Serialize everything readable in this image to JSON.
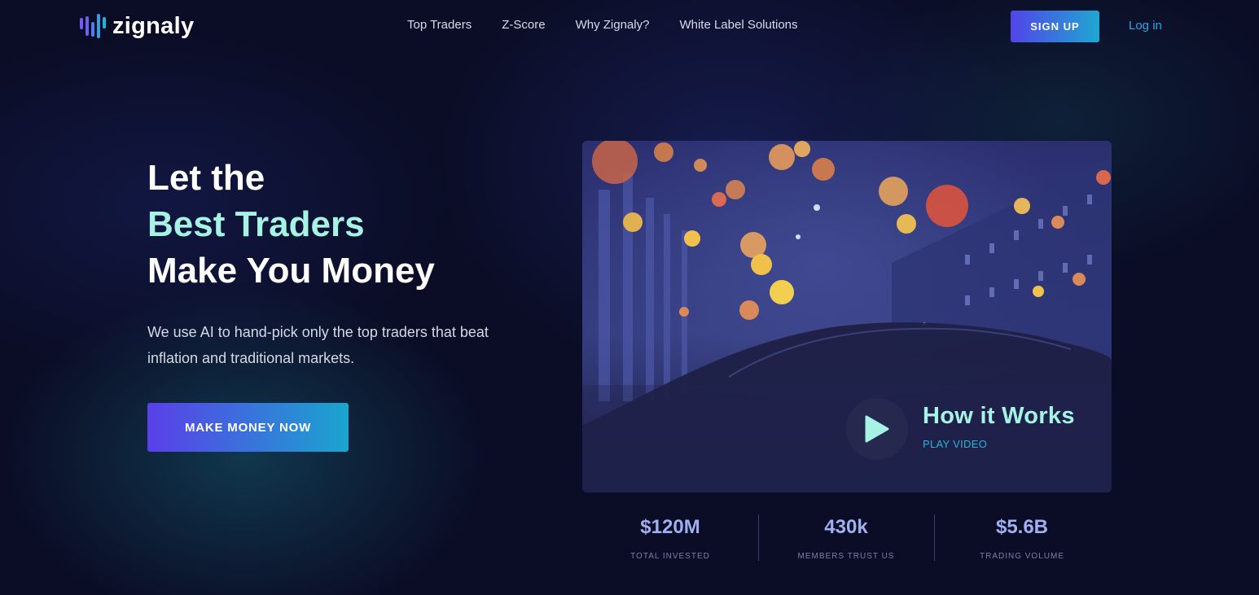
{
  "brand": {
    "name": "zignaly"
  },
  "nav": {
    "items": [
      {
        "label": "Top Traders"
      },
      {
        "label": "Z-Score"
      },
      {
        "label": "Why Zignaly?"
      },
      {
        "label": "White Label Solutions"
      }
    ],
    "signup_label": "SIGN UP",
    "login_label": "Log in"
  },
  "hero": {
    "line1": "Let the",
    "line2": "Best Traders",
    "line3": "Make You Money",
    "subtitle": "We use AI to hand-pick only the top traders that beat inflation and traditional markets.",
    "cta_label": "MAKE MONEY NOW"
  },
  "video": {
    "title": "How it Works",
    "subtitle": "PLAY VIDEO",
    "play_icon": "play-icon"
  },
  "stats": [
    {
      "value": "$120M",
      "label": "TOTAL INVESTED"
    },
    {
      "value": "430k",
      "label": "MEMBERS TRUST US"
    },
    {
      "value": "$5.6B",
      "label": "TRADING VOLUME"
    }
  ],
  "colors": {
    "background": "#0b0d26",
    "accent_mint": "#a6f3e4",
    "accent_blue": "#2fa4e7",
    "gradient_start": "#5145e8",
    "gradient_end": "#1fa6d1",
    "stat_value": "#9fb0f0"
  }
}
